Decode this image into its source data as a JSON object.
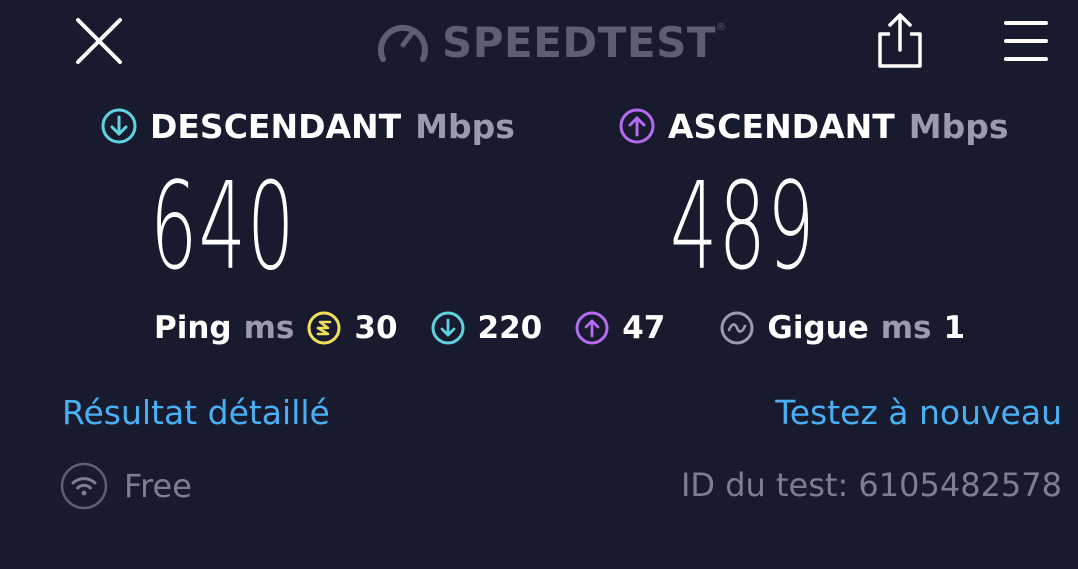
{
  "header": {
    "logo_text": "SPEEDTEST",
    "logo_tm": "®",
    "close_icon": "close-icon",
    "share_icon": "share-icon",
    "menu_icon": "menu-icon"
  },
  "download": {
    "label": "DESCENDANT",
    "unit": "Mbps",
    "value": "640",
    "icon": "download-arrow-icon",
    "color": "#5fd3e0"
  },
  "upload": {
    "label": "ASCENDANT",
    "unit": "Mbps",
    "value": "489",
    "icon": "upload-arrow-icon",
    "color": "#b36cf0"
  },
  "ping": {
    "label": "Ping",
    "unit": "ms",
    "idle_value": "30",
    "idle_color": "#f2e05a",
    "download_value": "220",
    "upload_value": "47"
  },
  "jitter": {
    "label": "Gigue",
    "unit": "ms",
    "value": "1"
  },
  "links": {
    "detailed_result": "Résultat détaillé",
    "test_again": "Testez à nouveau"
  },
  "footer": {
    "isp": "Free",
    "test_id_text": "ID du test: 6105482578"
  }
}
